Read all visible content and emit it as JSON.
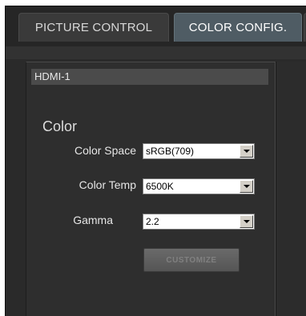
{
  "tabs": {
    "picture_control": "PICTURE CONTROL",
    "color_config": "COLOR CONFIG."
  },
  "panel": {
    "header": "HDMI-1",
    "section_title": "Color"
  },
  "fields": {
    "color_space": {
      "label": "Color Space",
      "value": "sRGB(709)"
    },
    "color_temp": {
      "label": "Color Temp",
      "value": "6500K"
    },
    "gamma": {
      "label": "Gamma",
      "value": "2.2"
    }
  },
  "customize_button": "CUSTOMIZE",
  "colors": {
    "active_tab": "#4f5c64",
    "background": "#2a2a2a",
    "panel_header": "#4b4b4b"
  }
}
